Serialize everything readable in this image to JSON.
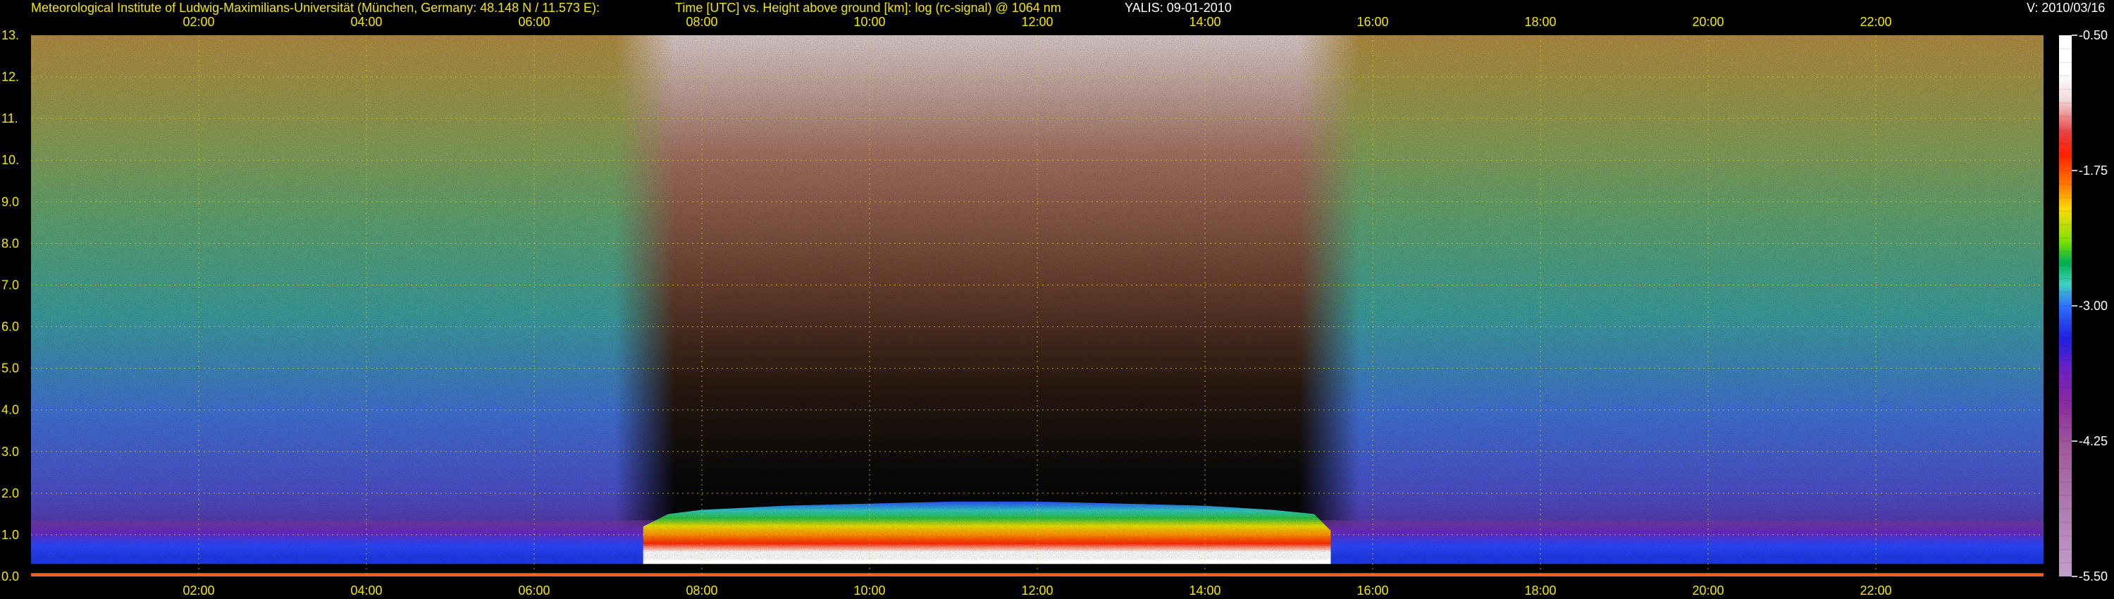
{
  "header": {
    "institute": "Meteorological Institute of Ludwig-Maximilians-Universität (München, Germany: 48.148 N / 11.573 E):",
    "plot_desc": "Time [UTC] vs. Height above ground [km]: log (rc-signal) @ 1064 nm",
    "instrument_date": "YALIS: 09-01-2010",
    "version": "V: 2010/03/16"
  },
  "chart_data": {
    "type": "heatmap",
    "x_axis": {
      "unit": "UTC",
      "range_hours": [
        0.0,
        24.0
      ],
      "tick_labels": [
        "02:00",
        "04:00",
        "06:00",
        "08:00",
        "10:00",
        "12:00",
        "14:00",
        "16:00",
        "18:00",
        "20:00",
        "22:00"
      ],
      "tick_hours": [
        2,
        4,
        6,
        8,
        10,
        12,
        14,
        16,
        18,
        20,
        22
      ]
    },
    "y_axis": {
      "unit": "km",
      "range": [
        0.0,
        13.0
      ],
      "tick_labels": [
        "0.0",
        "1.0",
        "2.0",
        "3.0",
        "4.0",
        "5.0",
        "6.0",
        "7.0",
        "8.0",
        "9.0",
        "10.",
        "11.",
        "12.",
        "13."
      ],
      "tick_values": [
        0,
        1,
        2,
        3,
        4,
        5,
        6,
        7,
        8,
        9,
        10,
        11,
        12,
        13
      ]
    },
    "grid": true,
    "colorbar": {
      "range": [
        -5.5,
        -0.5
      ],
      "tick_labels": [
        "-0.50",
        "-1.75",
        "-3.00",
        "-4.25",
        "-5.50"
      ],
      "tick_values": [
        -0.5,
        -1.75,
        -3.0,
        -4.25,
        -5.5
      ],
      "colors": [
        {
          "v": -0.5,
          "c": "#ffffff"
        },
        {
          "v": -0.85,
          "c": "#ffffff"
        },
        {
          "v": -1.1,
          "c": "#f0d8d8"
        },
        {
          "v": -1.4,
          "c": "#e84040"
        },
        {
          "v": -1.6,
          "c": "#ff2000"
        },
        {
          "v": -1.9,
          "c": "#ff8000"
        },
        {
          "v": -2.1,
          "c": "#ffd800"
        },
        {
          "v": -2.4,
          "c": "#80e000"
        },
        {
          "v": -2.6,
          "c": "#00b050"
        },
        {
          "v": -2.8,
          "c": "#40d0c0"
        },
        {
          "v": -3.0,
          "c": "#3070ff"
        },
        {
          "v": -3.3,
          "c": "#2020e0"
        },
        {
          "v": -3.6,
          "c": "#7020c0"
        },
        {
          "v": -3.9,
          "c": "#8a2aa0"
        },
        {
          "v": -4.3,
          "c": "#a05a9a"
        },
        {
          "v": -5.5,
          "c": "#c0a0c8"
        }
      ]
    },
    "features": {
      "boundary_layer_top_km": [
        [
          0,
          1.1
        ],
        [
          2,
          1.1
        ],
        [
          4,
          1.1
        ],
        [
          6,
          1.1
        ],
        [
          7.3,
          1.2
        ],
        [
          7.6,
          1.5
        ],
        [
          8,
          1.6
        ],
        [
          9,
          1.7
        ],
        [
          10,
          1.75
        ],
        [
          11,
          1.8
        ],
        [
          12,
          1.8
        ],
        [
          13,
          1.75
        ],
        [
          14,
          1.7
        ],
        [
          14.8,
          1.6
        ],
        [
          15.3,
          1.5
        ],
        [
          15.5,
          1.1
        ],
        [
          18,
          1.1
        ],
        [
          19,
          1.0
        ],
        [
          20,
          1.0
        ],
        [
          22,
          1.05
        ],
        [
          24,
          1.05
        ]
      ],
      "daytime_high_signal_hours": [
        7.3,
        15.5
      ]
    }
  }
}
